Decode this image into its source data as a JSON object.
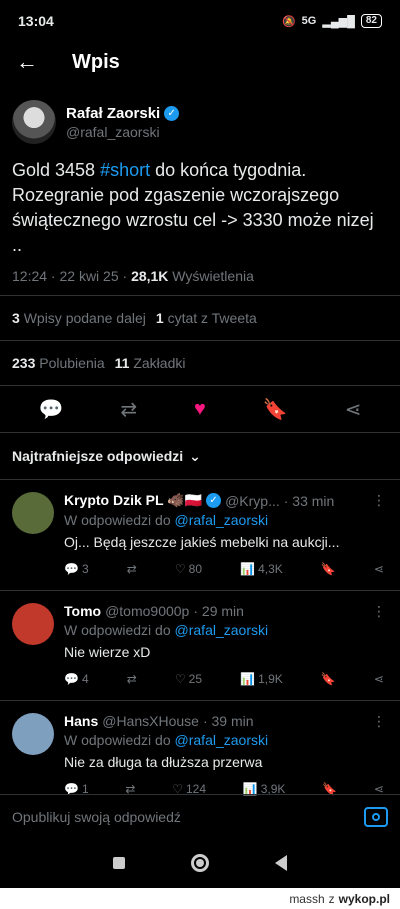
{
  "status": {
    "time": "13:04",
    "battery": "82",
    "signal": "5G"
  },
  "header": {
    "title": "Wpis"
  },
  "post": {
    "author_name": "Rafał Zaorski",
    "author_handle": "@rafal_zaorski",
    "text_before": "Gold 3458 ",
    "hashtag": "#short",
    "text_after": " do końca tygodnia. Rozegranie pod zgaszenie wczorajszego świątecznego wzrostu cel -> 3330 może nizej ..",
    "time": "12:24 · 22 kwi 25 · ",
    "views": "28,1K",
    "views_label": " Wyświetlenia",
    "reposts_count": "3",
    "reposts_label": "Wpisy podane dalej",
    "quotes_count": "1",
    "quotes_label": "cytat z Tweeta",
    "likes_count": "233",
    "likes_label": "Polubienia",
    "bookmarks_count": "11",
    "bookmarks_label": "Zakładki"
  },
  "sort_label": "Najtrafniejsze odpowiedzi",
  "replies": [
    {
      "name": "Krypto Dzik PL 🐗🇵🇱",
      "handle": "@Kryp...",
      "time": "· 33 min",
      "reply_to_prefix": "W odpowiedzi do ",
      "reply_to": "@rafal_zaorski",
      "text": "Oj... Będą jeszcze jakieś mebelki na aukcji...",
      "comments": "3",
      "reposts": "",
      "likes": "80",
      "views": "4,3K",
      "avatar_color": "#5a6b3a"
    },
    {
      "name": "Tomo",
      "handle": "@tomo9000p",
      "time": "· 29 min",
      "reply_to_prefix": "W odpowiedzi do ",
      "reply_to": "@rafal_zaorski",
      "text": "Nie wierze xD",
      "comments": "4",
      "reposts": "",
      "likes": "25",
      "views": "1,9K",
      "avatar_color": "#c0392b"
    },
    {
      "name": "Hans",
      "handle": "@HansXHouse",
      "time": "· 39 min",
      "reply_to_prefix": "W odpowiedzi do ",
      "reply_to": "@rafal_zaorski",
      "text": "Nie za długa ta dłuższa przerwa",
      "comments": "1",
      "reposts": "",
      "likes": "124",
      "views": "3,9K",
      "avatar_color": "#7f9fbf"
    }
  ],
  "compose": {
    "placeholder": "Opublikuj swoją odpowiedź"
  },
  "watermark": {
    "user": "massh",
    "prefix": "z",
    "site": "wykop.pl"
  }
}
